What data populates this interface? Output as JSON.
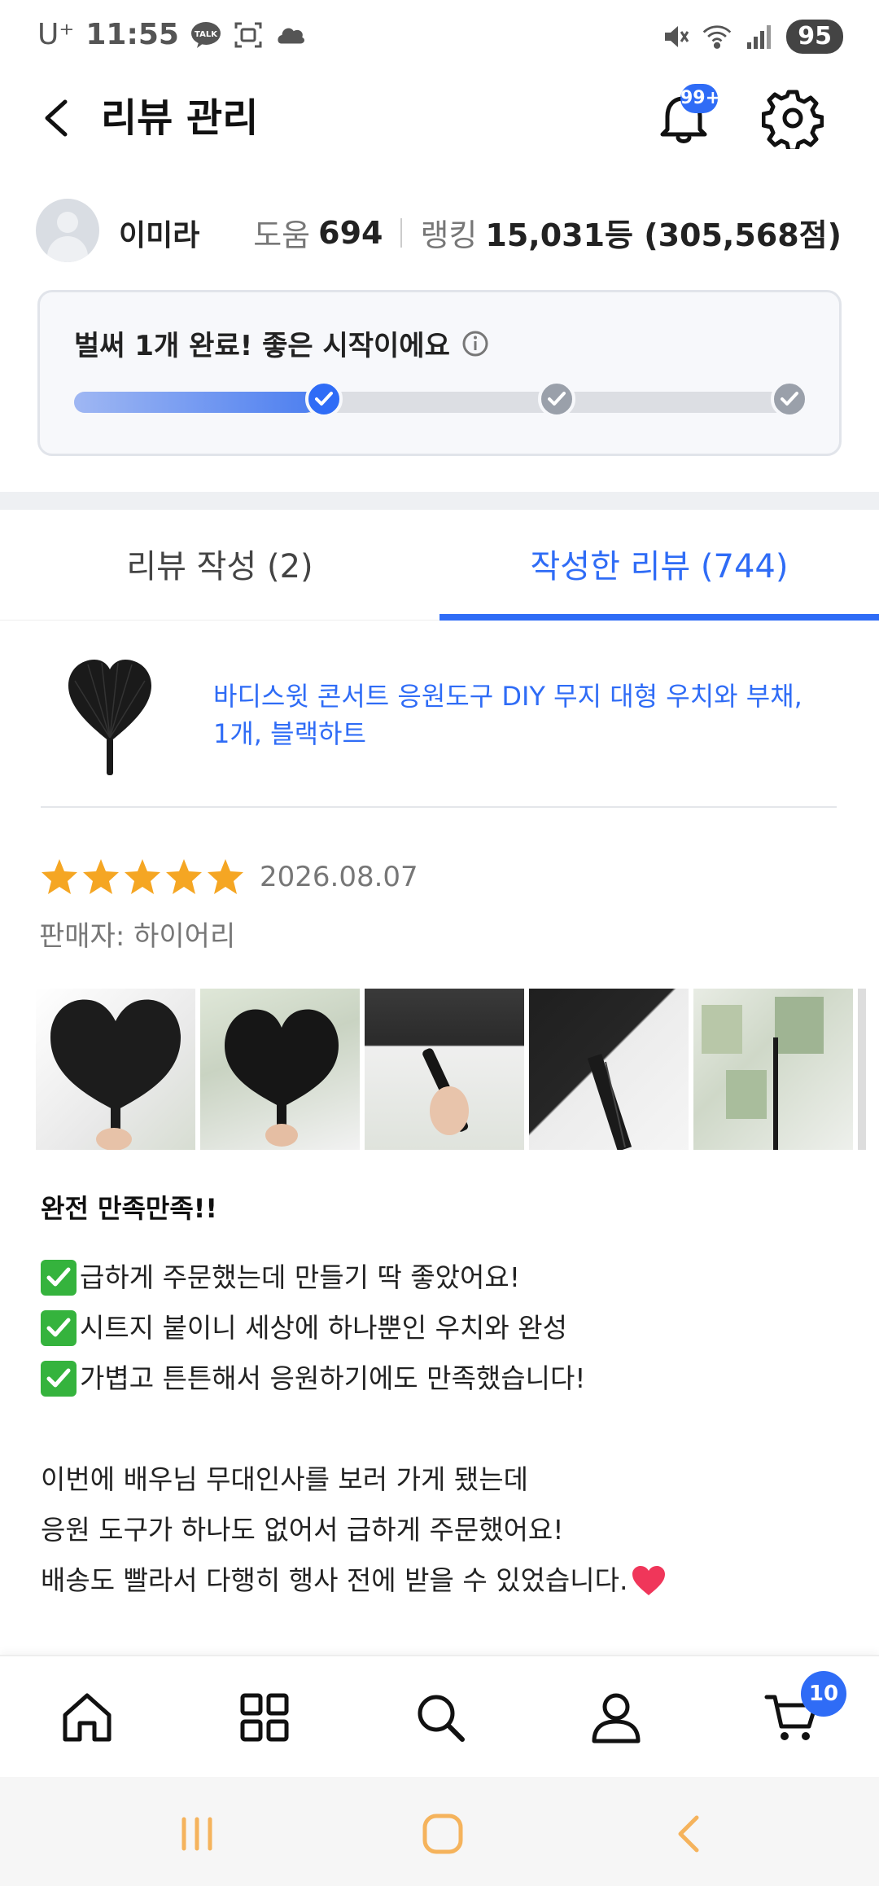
{
  "status_bar": {
    "carrier": "U⁺",
    "time": "11:55",
    "battery": "95",
    "icons": [
      "talk-icon",
      "screenshot-icon",
      "cloud-icon",
      "mute-icon",
      "wifi-icon",
      "signal-icon"
    ]
  },
  "header": {
    "title": "리뷰 관리",
    "bell_badge": "99+"
  },
  "profile": {
    "name": "이미라",
    "help_label": "도움",
    "help_value": "694",
    "rank_label": "랭킹",
    "rank_value": "15,031등 (305,568점)"
  },
  "progress": {
    "title": "벌써 1개 완료! 좋은 시작이에요",
    "steps_total": 3,
    "steps_done": 1,
    "fill_fraction": 0.33
  },
  "tabs": [
    {
      "label": "리뷰 작성 (2)",
      "active": false
    },
    {
      "label": "작성한 리뷰 (744)",
      "active": true
    }
  ],
  "product": {
    "name": "바디스윗 콘서트 응원도구 DIY 무지 대형 우치와 부채, 1개, 블랙하트"
  },
  "review": {
    "stars": 5,
    "date": "2026.08.07",
    "seller": "판매자: 하이어리",
    "photo_count_visible": 5,
    "headline": "완전 만족만족!!",
    "checks": [
      "급하게 주문했는데 만들기 딱 좋았어요!",
      "시트지 붙이니 세상에 하나뿐인 우치와 완성",
      "가볍고 튼튼해서 응원하기에도 만족했습니다!"
    ],
    "paragraph": [
      "이번에 배우님 무대인사를 보러 가게 됐는데",
      "응원 도구가 하나도 없어서 급하게 주문했어요!",
      "배송도 빨라서 다행히 행사 전에 받을 수 있었습니다."
    ]
  },
  "bottom_nav": {
    "items": [
      "home-icon",
      "category-icon",
      "search-icon",
      "profile-icon",
      "cart-icon"
    ],
    "cart_badge": "10"
  },
  "colors": {
    "accent": "#2f6cf6",
    "star": "#f5a623",
    "check": "#35b33d",
    "heart": "#f0365a",
    "system_nav": "#f5b35c"
  }
}
